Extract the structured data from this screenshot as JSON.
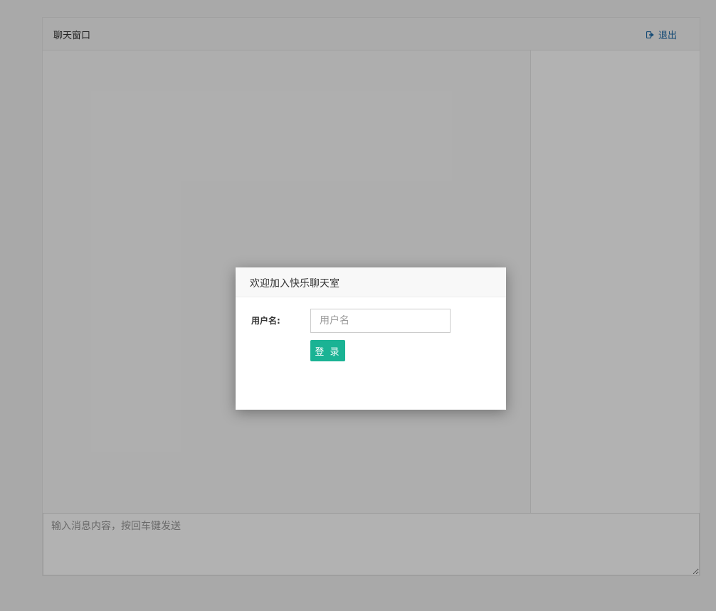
{
  "chat": {
    "title": "聊天窗口",
    "logout_label": "退出",
    "input_placeholder": "输入消息内容，按回车键发送"
  },
  "login_modal": {
    "title": "欢迎加入快乐聊天室",
    "username_label": "用户名:",
    "username_placeholder": "用户名",
    "username_value": "",
    "login_button": "登 录"
  },
  "colors": {
    "accent": "#1ab394",
    "link": "#1e6aa8"
  },
  "icons": {
    "logout": "sign-out-icon"
  }
}
